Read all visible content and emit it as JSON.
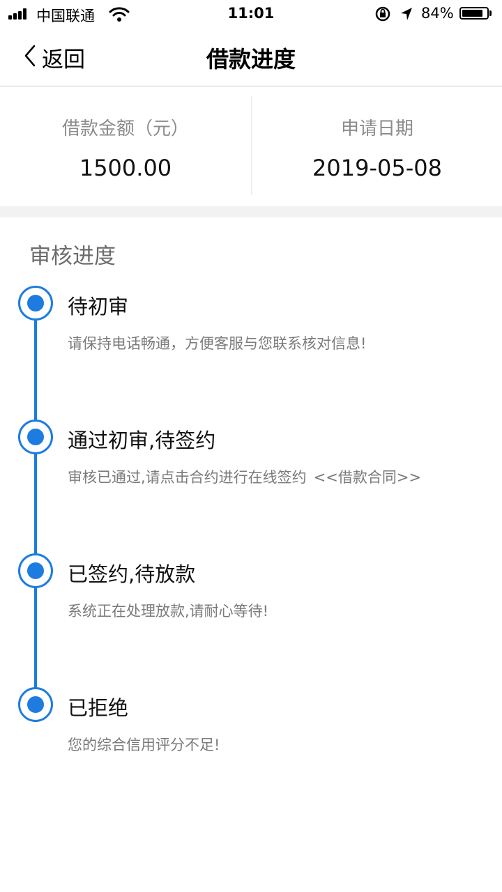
{
  "status_bar": {
    "carrier": "中国联通",
    "time": "11:01",
    "battery_percent": "84%",
    "battery_level": 0.84,
    "icons": [
      "signal-icon",
      "wifi-icon",
      "orientation-lock-icon",
      "location-arrow-icon",
      "battery-icon"
    ]
  },
  "nav": {
    "back_label": "返回",
    "title": "借款进度"
  },
  "summary": {
    "amount_label": "借款金额（元）",
    "amount_value": "1500.00",
    "date_label": "申请日期",
    "date_value": "2019-05-08"
  },
  "progress": {
    "title": "审核进度",
    "steps": [
      {
        "title": "待初审",
        "desc": "请保持电话畅通，方便客服与您联系核对信息!"
      },
      {
        "title": "通过初审,待签约",
        "desc": "审核已通过,请点击合约进行在线签约",
        "link": "<<借款合同>>"
      },
      {
        "title": "已签约,待放款",
        "desc": "系统正在处理放款,请耐心等待!"
      },
      {
        "title": "已拒绝",
        "desc": "您的综合信用评分不足!"
      }
    ]
  },
  "colors": {
    "accent": "#1e7ce0",
    "muted_text": "#7a7a7a",
    "separator": "#f2f2f2"
  }
}
